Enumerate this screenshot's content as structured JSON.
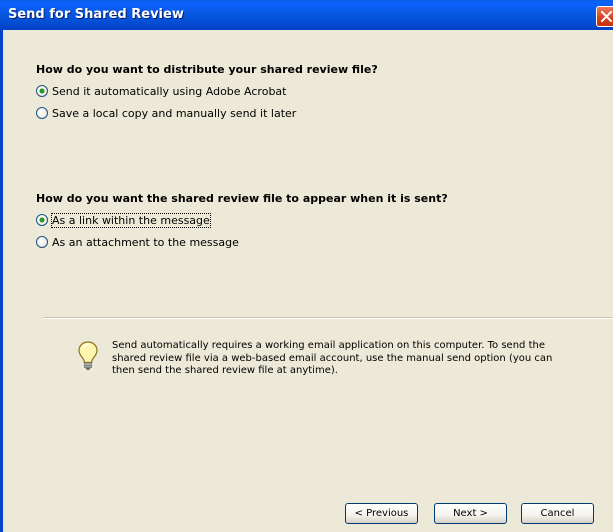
{
  "window": {
    "title": "Send for Shared Review"
  },
  "distribution": {
    "question": "How do you want to distribute your shared review file?",
    "options": [
      {
        "label": "Send it automatically using Adobe Acrobat",
        "checked": true
      },
      {
        "label": "Save a local copy and manually send it later",
        "checked": false
      }
    ]
  },
  "appearance": {
    "question": "How do you want the shared review file to appear when it is sent?",
    "options": [
      {
        "label": "As a link within the message",
        "checked": true
      },
      {
        "label": "As an attachment to the message",
        "checked": false
      }
    ]
  },
  "info": {
    "icon": "lightbulb-icon",
    "text": "Send automatically requires a working email application on this computer. To send the shared review file via a web-based email account, use the manual send option (you can then send the shared review file at anytime)."
  },
  "buttons": {
    "previous": "< Previous",
    "next": "Next >",
    "cancel": "Cancel"
  },
  "colors": {
    "titlebar": "#0a5ae6",
    "dialog_bg": "#ece9d8",
    "radio_dot": "#21a121"
  }
}
